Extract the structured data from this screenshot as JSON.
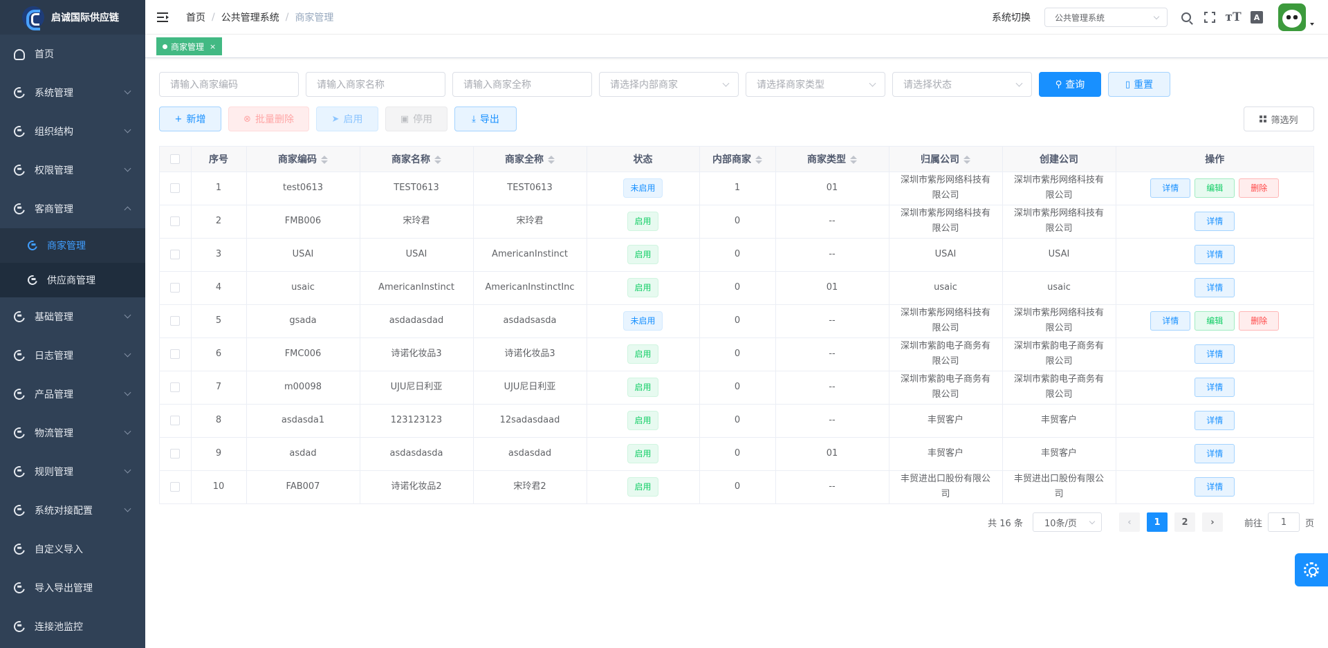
{
  "app": {
    "title": "启诚国际供应链"
  },
  "sidebar": {
    "items": [
      {
        "label": "首页",
        "icon": "dashboard-icon"
      },
      {
        "label": "系统管理",
        "icon": "menu-icon"
      },
      {
        "label": "组织结构",
        "icon": "menu-icon"
      },
      {
        "label": "权限管理",
        "icon": "menu-icon"
      },
      {
        "label": "客商管理",
        "icon": "menu-icon"
      },
      {
        "label": "基础管理",
        "icon": "menu-icon"
      },
      {
        "label": "日志管理",
        "icon": "menu-icon"
      },
      {
        "label": "产品管理",
        "icon": "menu-icon"
      },
      {
        "label": "物流管理",
        "icon": "menu-icon"
      },
      {
        "label": "规则管理",
        "icon": "menu-icon"
      },
      {
        "label": "系统对接配置",
        "icon": "menu-icon"
      },
      {
        "label": "自定义导入",
        "icon": "menu-icon"
      },
      {
        "label": "导入导出管理",
        "icon": "menu-icon"
      },
      {
        "label": "连接池监控",
        "icon": "menu-icon"
      }
    ],
    "sub": [
      {
        "label": "商家管理"
      },
      {
        "label": "供应商管理"
      }
    ]
  },
  "header": {
    "breadcrumb": [
      "首页",
      "公共管理系统",
      "商家管理"
    ],
    "sys_label": "系统切换",
    "sys_value": "公共管理系统"
  },
  "tags": {
    "active": "商家管理",
    "close": "×"
  },
  "filters": {
    "code": "请输入商家编码",
    "name": "请输入商家名称",
    "fullname": "请输入商家全称",
    "internal": "请选择内部商家",
    "type": "请选择商家类型",
    "status": "请选择状态",
    "query": "查询",
    "reset": "重置"
  },
  "actions": {
    "add": "新增",
    "batch_delete": "批量删除",
    "enable": "启用",
    "disable": "停用",
    "export": "导出",
    "filter_cols": "筛选列"
  },
  "table": {
    "headers": [
      "序号",
      "商家编码",
      "商家名称",
      "商家全称",
      "状态",
      "内部商家",
      "商家类型",
      "归属公司",
      "创建公司",
      "操作"
    ],
    "ops": {
      "detail": "详情",
      "edit": "编辑",
      "delete": "删除"
    },
    "rows": [
      {
        "no": "1",
        "code": "test0613",
        "name": "TEST0613",
        "fullname": "TEST0613",
        "status": "未启用",
        "internal": "1",
        "type": "01",
        "owner": "深圳市紫彤网络科技有限公司",
        "creator": "深圳市紫彤网络科技有限公司"
      },
      {
        "no": "2",
        "code": "FMB006",
        "name": "宋玲君",
        "fullname": "宋玲君",
        "status": "启用",
        "internal": "0",
        "type": "--",
        "owner": "深圳市紫彤网络科技有限公司",
        "creator": "深圳市紫彤网络科技有限公司"
      },
      {
        "no": "3",
        "code": "USAI",
        "name": "USAI",
        "fullname": "AmericanInstinct",
        "status": "启用",
        "internal": "0",
        "type": "--",
        "owner": "USAI",
        "creator": "USAI"
      },
      {
        "no": "4",
        "code": "usaic",
        "name": "AmericanInstinct",
        "fullname": "AmericanInstinctInc",
        "status": "启用",
        "internal": "0",
        "type": "01",
        "owner": "usaic",
        "creator": "usaic"
      },
      {
        "no": "5",
        "code": "gsada",
        "name": "asdadasdad",
        "fullname": "asdadsasda",
        "status": "未启用",
        "internal": "0",
        "type": "--",
        "owner": "深圳市紫彤网络科技有限公司",
        "creator": "深圳市紫彤网络科技有限公司"
      },
      {
        "no": "6",
        "code": "FMC006",
        "name": "诗诺化妆品3",
        "fullname": "诗诺化妆品3",
        "status": "启用",
        "internal": "0",
        "type": "--",
        "owner": "深圳市紫韵电子商务有限公司",
        "creator": "深圳市紫韵电子商务有限公司"
      },
      {
        "no": "7",
        "code": "m00098",
        "name": "UJU尼日利亚",
        "fullname": "UJU尼日利亚",
        "status": "启用",
        "internal": "0",
        "type": "--",
        "owner": "深圳市紫韵电子商务有限公司",
        "creator": "深圳市紫韵电子商务有限公司"
      },
      {
        "no": "8",
        "code": "asdasda1",
        "name": "123123123",
        "fullname": "12sadasdaad",
        "status": "启用",
        "internal": "0",
        "type": "--",
        "owner": "丰贸客户",
        "creator": "丰贸客户"
      },
      {
        "no": "9",
        "code": "asdad",
        "name": "asdasdasda",
        "fullname": "asdasdad",
        "status": "启用",
        "internal": "0",
        "type": "01",
        "owner": "丰贸客户",
        "creator": "丰贸客户"
      },
      {
        "no": "10",
        "code": "FAB007",
        "name": "诗诺化妆品2",
        "fullname": "宋玲君2",
        "status": "启用",
        "internal": "0",
        "type": "--",
        "owner": "丰贸进出口股份有限公司",
        "creator": "丰贸进出口股份有限公司"
      }
    ]
  },
  "pagination": {
    "total": "共 16 条",
    "page_size": "10条/页",
    "prev": "‹",
    "next": "›",
    "pages": [
      "1",
      "2"
    ],
    "goto_prefix": "前往",
    "goto_value": "1",
    "goto_suffix": "页"
  },
  "colors": {
    "primary": "#1890ff",
    "sidebar_bg": "#304156",
    "tag_green": "#42b983",
    "success": "#13ce66",
    "danger": "#ff4949"
  }
}
